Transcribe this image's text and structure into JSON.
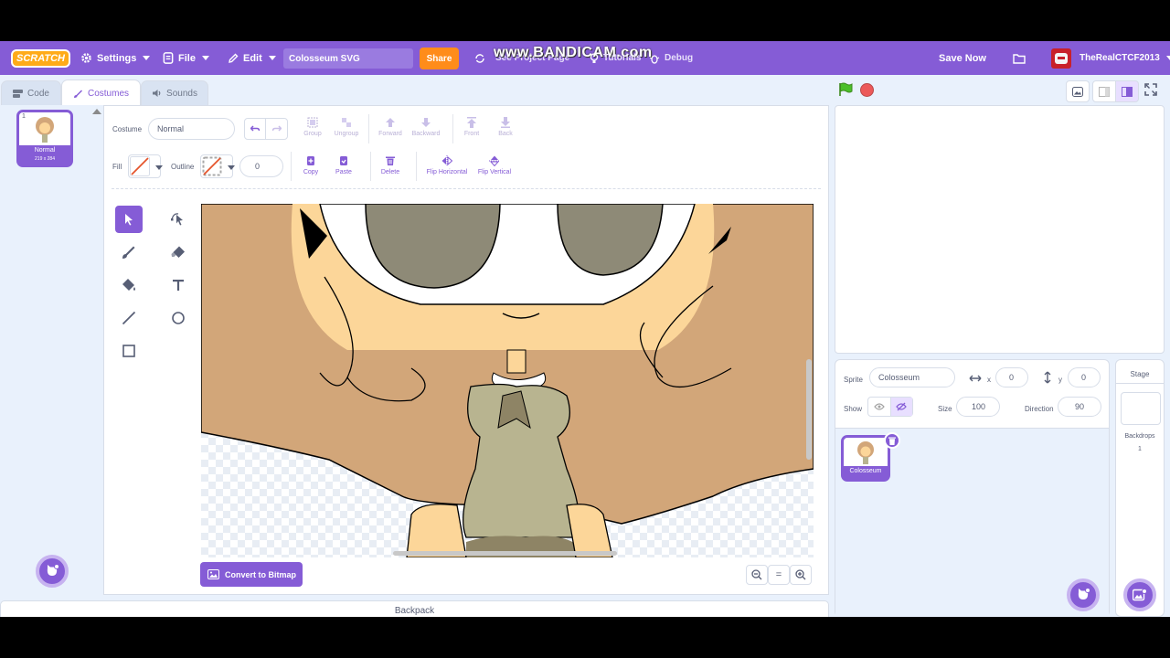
{
  "app": {
    "logo": "SCRATCH",
    "watermark": "www.BANDICAM.com"
  },
  "menu": {
    "settings": "Settings",
    "file": "File",
    "edit": "Edit",
    "project_title": "Colosseum SVG",
    "share": "Share",
    "see_project_page": "See Project Page",
    "tutorials": "Tutorials",
    "debug": "Debug",
    "save_now": "Save Now",
    "username": "TheRealCTCF2013"
  },
  "tabs": {
    "code": "Code",
    "costumes": "Costumes",
    "sounds": "Sounds"
  },
  "costume_list": [
    {
      "number": "1",
      "name": "Normal",
      "size": "219 x 284"
    }
  ],
  "paint_editor": {
    "costume_label": "Costume",
    "costume_name": "Normal",
    "group": "Group",
    "ungroup": "Ungroup",
    "forward": "Forward",
    "backward": "Backward",
    "front": "Front",
    "back": "Back",
    "fill_label": "Fill",
    "outline_label": "Outline",
    "outline_width": "0",
    "copy": "Copy",
    "paste": "Paste",
    "delete": "Delete",
    "flip_horizontal": "Flip Horizontal",
    "flip_vertical": "Flip Vertical",
    "convert_button": "Convert to Bitmap",
    "zoom_reset": "="
  },
  "backpack": "Backpack",
  "sprite_info": {
    "sprite_label": "Sprite",
    "sprite_name": "Colosseum",
    "x_label": "x",
    "x_value": "0",
    "y_label": "y",
    "y_value": "0",
    "show_label": "Show",
    "size_label": "Size",
    "size_value": "100",
    "direction_label": "Direction",
    "direction_value": "90"
  },
  "sprites": [
    {
      "name": "Colosseum"
    }
  ],
  "stage_pane": {
    "title": "Stage",
    "backdrops_label": "Backdrops",
    "backdrops_count": "1"
  },
  "colors": {
    "accent": "#855cd6",
    "share": "#ff8c1a",
    "hair": "#d2a679",
    "skin": "#fcd699",
    "eye": "#8e8a77",
    "dress": "#b8b490"
  }
}
